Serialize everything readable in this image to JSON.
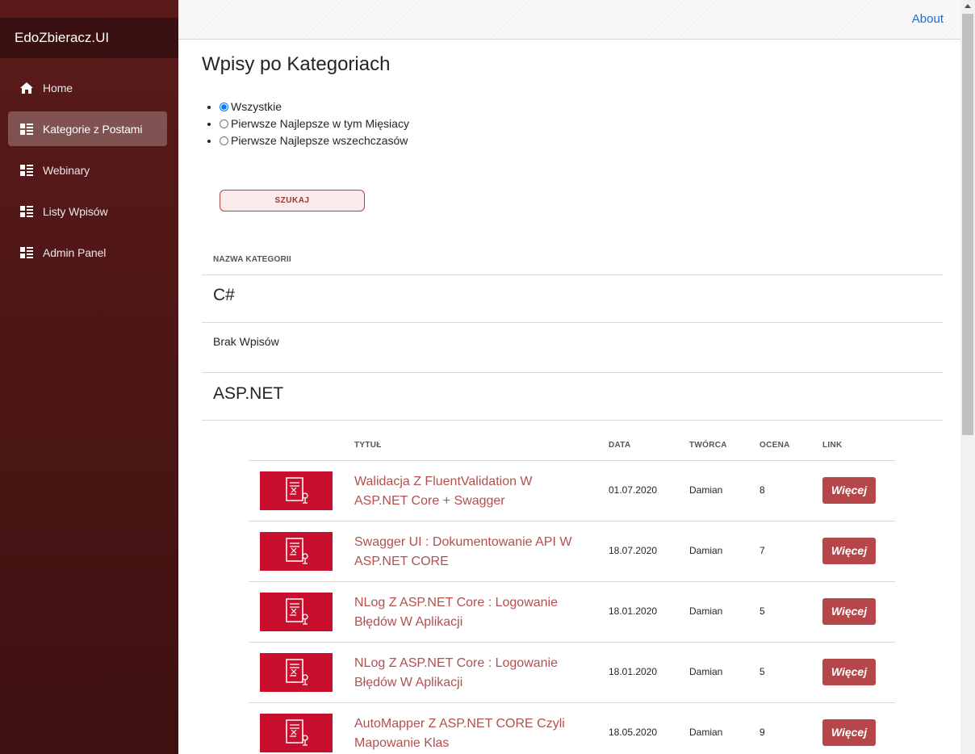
{
  "sidebar": {
    "brand": "EdoZbieracz.UI",
    "items": [
      {
        "label": "Home",
        "icon": "home-icon",
        "active": false
      },
      {
        "label": "Kategorie z Postami",
        "icon": "list-icon",
        "active": true
      },
      {
        "label": "Webinary",
        "icon": "list-icon",
        "active": false
      },
      {
        "label": "Listy Wpisów",
        "icon": "list-icon",
        "active": false
      },
      {
        "label": "Admin Panel",
        "icon": "list-icon",
        "active": false
      }
    ]
  },
  "topbar": {
    "about": "About"
  },
  "page": {
    "title": "Wpisy po Kategoriach",
    "filters": [
      {
        "label": "Wszystkie",
        "checked": true
      },
      {
        "label": "Pierwsze Najlepsze w tym Mięsiacy",
        "checked": false
      },
      {
        "label": "Pierwsze Najlepsze wszechczasów",
        "checked": false
      }
    ],
    "search_button": "SZUKAJ",
    "category_header": "NAZWA KATEGORII",
    "categories": [
      {
        "name": "C#",
        "empty_text": "Brak Wpisów"
      },
      {
        "name": "ASP.NET"
      }
    ],
    "posts_table": {
      "headers": {
        "title": "TYTUŁ",
        "date": "DATA",
        "author": "TWÓRCA",
        "rating": "OCENA",
        "link": "LINK"
      },
      "rows": [
        {
          "title": "Walidacja Z FluentValidation W ASP.NET Core + Swagger",
          "date": "01.07.2020",
          "author": "Damian",
          "rating": "8",
          "link_label": "Więcej"
        },
        {
          "title": "Swagger UI : Dokumentowanie API W ASP.NET CORE",
          "date": "18.07.2020",
          "author": "Damian",
          "rating": "7",
          "link_label": "Więcej"
        },
        {
          "title": "NLog Z ASP.NET Core : Logowanie Błędów W Aplikacji",
          "date": "18.01.2020",
          "author": "Damian",
          "rating": "5",
          "link_label": "Więcej"
        },
        {
          "title": "NLog Z ASP.NET Core : Logowanie Błędów W Aplikacji",
          "date": "18.01.2020",
          "author": "Damian",
          "rating": "5",
          "link_label": "Więcej"
        },
        {
          "title": "AutoMapper Z ASP.NET CORE Czyli Mapowanie Klas",
          "date": "18.05.2020",
          "author": "Damian",
          "rating": "9",
          "link_label": "Więcej"
        }
      ]
    }
  },
  "colors": {
    "sidebar": "#4a1515",
    "accent": "#b5474b",
    "link": "#b2504f",
    "thumbnail": "#c8102e",
    "about_link": "#1b6ec2"
  }
}
